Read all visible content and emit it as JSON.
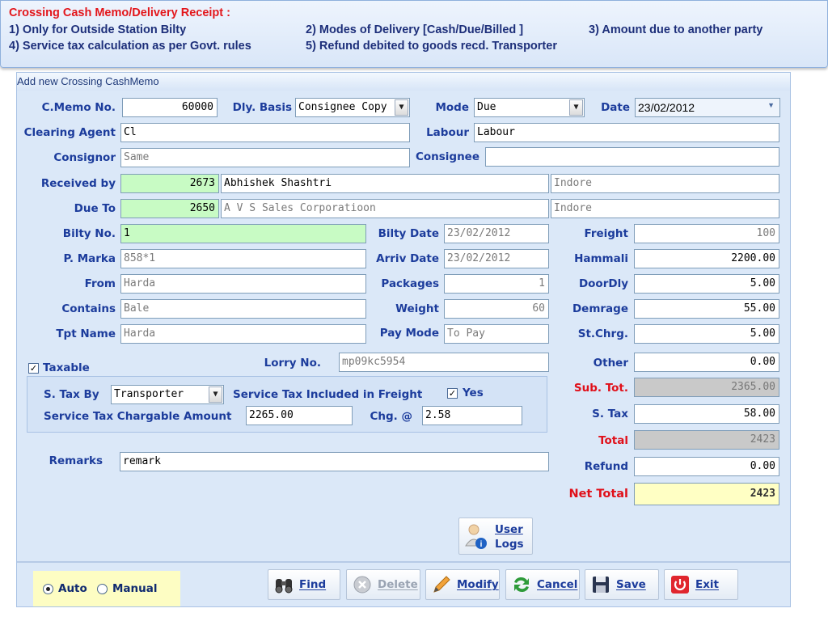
{
  "banner": {
    "title": "Crossing Cash Memo/Delivery Receipt :",
    "items": [
      "1)   Only for Outside Station  Bilty",
      "2)  Modes of Delivery [Cash/Due/Billed ]",
      "3)  Amount due to another party",
      "4)   Service tax calculation  as per Govt. rules",
      "5)  Refund debited to goods recd. Transporter"
    ]
  },
  "window": {
    "title": "Add new Crossing CashMemo"
  },
  "form": {
    "labels": {
      "cmemo": "C.Memo No.",
      "dly_basis": "Dly. Basis",
      "mode": "Mode",
      "date": "Date",
      "clearing_agent": "Clearing Agent",
      "labour": "Labour",
      "consignor": "Consignor",
      "consignee": "Consignee",
      "received_by": "Received by",
      "due_to": "Due To",
      "bilty_no": "Bilty No.",
      "bilty_date": "Bilty Date",
      "p_marka": "P. Marka",
      "arriv_date": "Arriv Date",
      "from": "From",
      "packages": "Packages",
      "contains": "Contains",
      "weight": "Weight",
      "tpt_name": "Tpt Name",
      "pay_mode": "Pay Mode",
      "taxable": "Taxable",
      "lorry_no": "Lorry No.",
      "s_tax_by": "S. Tax By",
      "service_tax_included": "Service Tax Included in Freight",
      "yes": "Yes",
      "service_tax_chargable": "Service Tax Chargable Amount",
      "chg": "Chg. @",
      "remarks": "Remarks",
      "freight": "Freight",
      "hammali": "Hammali",
      "doordly": "DoorDly",
      "demrage": "Demrage",
      "st_chrg": "St.Chrg.",
      "other": "Other",
      "sub_tot": "Sub. Tot.",
      "s_tax": "S. Tax",
      "total": "Total",
      "refund": "Refund",
      "net_total": "Net Total"
    },
    "values": {
      "cmemo": "60000",
      "dly_basis": "Consignee Copy",
      "mode": "Due",
      "date": "23/02/2012",
      "clearing_agent": "Cl",
      "labour": "Labour",
      "consignor": "Same",
      "consignee": "",
      "received_by_code": "2673",
      "received_by_name": "Abhishek Shashtri",
      "received_by_city": "Indore",
      "due_to_code": "2650",
      "due_to_name": "A V S Sales Corporatioon",
      "due_to_city": "Indore",
      "bilty_no": "1",
      "bilty_date": "23/02/2012",
      "p_marka": "858*1",
      "arriv_date": "23/02/2012",
      "from": "Harda",
      "packages": "1",
      "contains": "Bale",
      "weight": "60",
      "tpt_name": "Harda",
      "pay_mode": "To Pay",
      "lorry_no": "mp09kc5954",
      "s_tax_by": "Transporter",
      "service_tax_chargable": "2265.00",
      "chg": "2.58",
      "remarks": "remark",
      "freight": "100",
      "hammali": "2200.00",
      "doordly": "5.00",
      "demrage": "55.00",
      "st_chrg": "5.00",
      "other": "0.00",
      "sub_tot": "2365.00",
      "s_tax": "58.00",
      "total": "2423",
      "refund": "0.00",
      "net_total": "2423"
    },
    "checks": {
      "taxable": true,
      "yes": true
    }
  },
  "user_logs": {
    "line1": "User",
    "line2": "Logs"
  },
  "bottom": {
    "radio_auto": "Auto",
    "radio_manual": "Manual",
    "selected": "Auto",
    "buttons": {
      "find": "Find",
      "delete": "Delete",
      "modify": "Modify",
      "cancel": "Cancel",
      "save": "Save",
      "exit": "Exit"
    }
  }
}
